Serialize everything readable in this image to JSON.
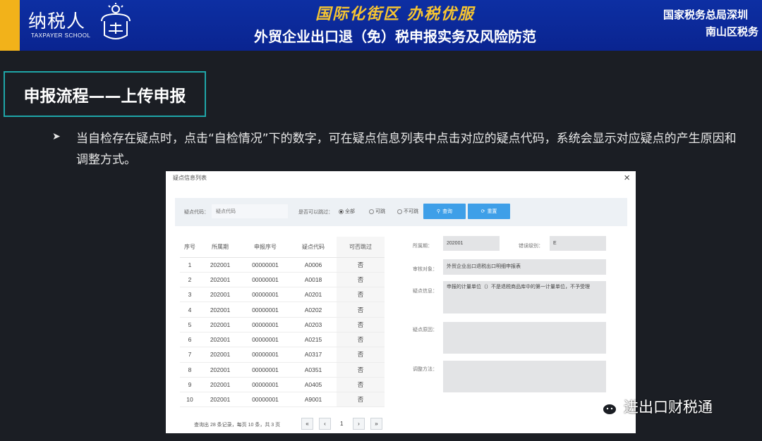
{
  "header": {
    "logo_text": "纳税人",
    "logo_sub": "TAXPAYER SCHOOL",
    "slogan": "国际化街区 办税优服",
    "course_title": "外贸企业出口退（免）税申报实务及风险防范",
    "org_line1": "国家税务总局深圳",
    "org_line2": "南山区税务",
    "colors": {
      "banner": "#0d2fa3",
      "strip": "#f2b21a",
      "slogan": "#f7c531"
    }
  },
  "section": {
    "heading": "申报流程——上传申报",
    "bullet": "➤",
    "text": "当自检存在疑点时，点击“自检情况”下的数字，可在疑点信息列表中点击对应的疑点代码，系统会显示对应疑点的产生原因和调整方式。"
  },
  "dialog": {
    "title": "疑点信息列表",
    "close": "×",
    "filter": {
      "code_label": "疑点代码：",
      "code_placeholder": "疑点代码",
      "pass_label": "是否可以跳过：",
      "options": [
        "全部",
        "可跳",
        "不可跳"
      ],
      "selected": "全部",
      "query_btn": "查询",
      "reset_btn": "重置"
    },
    "table": {
      "headers": [
        "序号",
        "所属期",
        "申报序号",
        "疑点代码",
        "可否跳过"
      ],
      "rows": [
        [
          "1",
          "202001",
          "00000001",
          "A0006",
          "否"
        ],
        [
          "2",
          "202001",
          "00000001",
          "A0018",
          "否"
        ],
        [
          "3",
          "202001",
          "00000001",
          "A0201",
          "否"
        ],
        [
          "4",
          "202001",
          "00000001",
          "A0202",
          "否"
        ],
        [
          "5",
          "202001",
          "00000001",
          "A0203",
          "否"
        ],
        [
          "6",
          "202001",
          "00000001",
          "A0215",
          "否"
        ],
        [
          "7",
          "202001",
          "00000001",
          "A0317",
          "否"
        ],
        [
          "8",
          "202001",
          "00000001",
          "A0351",
          "否"
        ],
        [
          "9",
          "202001",
          "00000001",
          "A0405",
          "否"
        ],
        [
          "10",
          "202001",
          "00000001",
          "A9001",
          "否"
        ]
      ]
    },
    "detail": {
      "period_label": "所属期：",
      "period_value": "202001",
      "level_label": "错误级别：",
      "level_value": "E",
      "object_label": "审核对象：",
      "object_value": "外贸企业出口退税出口明细申报表",
      "info_label": "疑点信息：",
      "info_value": "申报的计量单位（）不是退税商品库中的第一计量单位，不予受理",
      "reason_label": "疑点原因：",
      "reason_value": "",
      "method_label": "调整方法：",
      "method_value": ""
    },
    "pager": {
      "info": "查询出 28 条记录，每页 10 条，共 3 页",
      "first": "«",
      "prev": "‹",
      "current": "1",
      "next": "›",
      "last": "»"
    }
  },
  "watermark": {
    "icon": "wechat-icon",
    "text": "进出口财税通"
  }
}
